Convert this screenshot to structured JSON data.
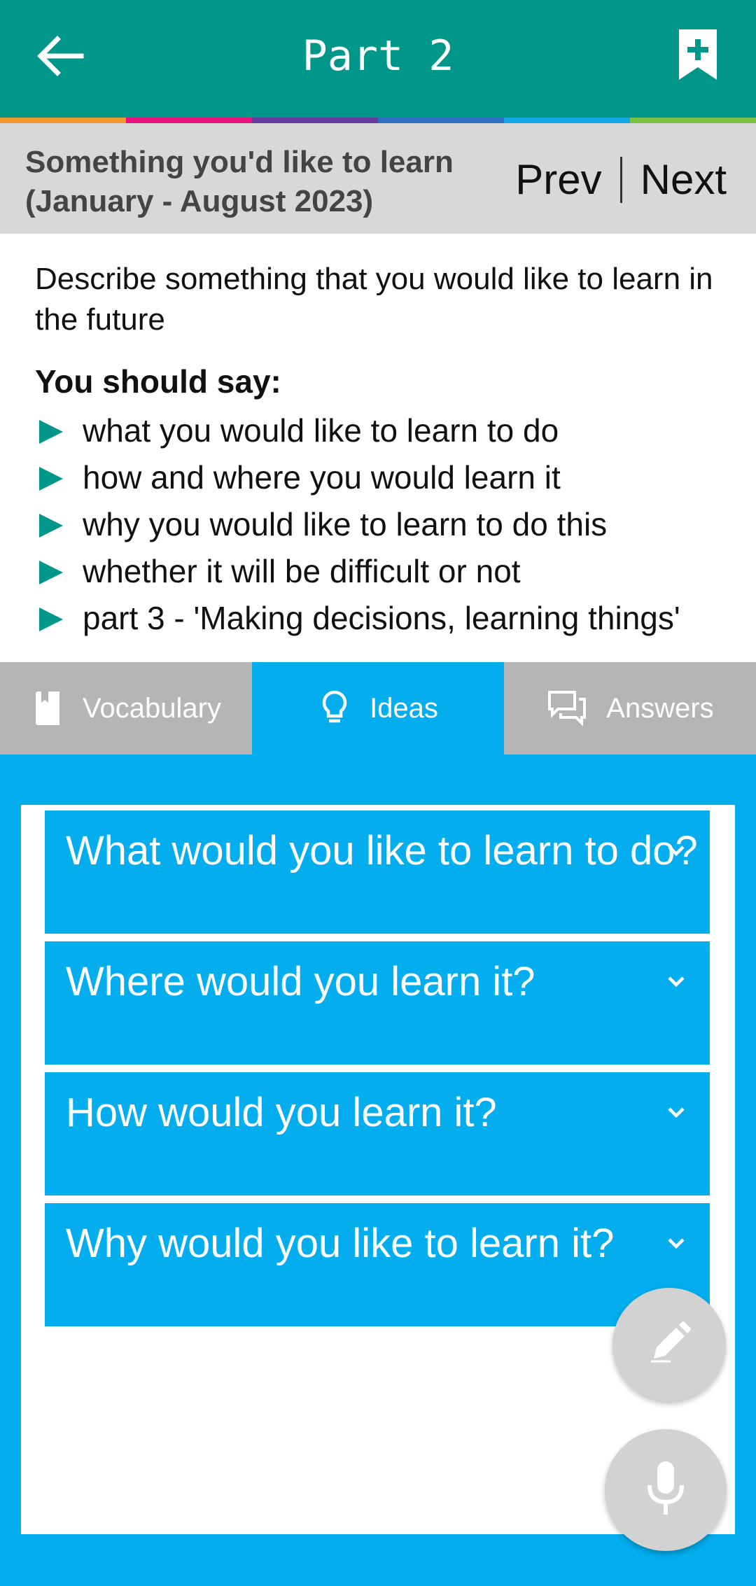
{
  "appbar": {
    "title": "Part 2",
    "back_icon": "arrow-left-icon",
    "bookmark_icon": "bookmark-add-icon"
  },
  "stripe_colors": [
    "#f19a2b",
    "#e9137d",
    "#6a3b9e",
    "#2e6fc0",
    "#12a9e6",
    "#7bc043"
  ],
  "topic": {
    "title_line1": "Something you'd like to learn",
    "title_line2": "(January - August 2023)",
    "prev_label": "Prev",
    "next_label": "Next"
  },
  "cue_card": {
    "prompt": "Describe something that you would like to learn in the future",
    "say_heading": "You should say:",
    "points": [
      "what you would like to learn to do",
      "how and where you would learn it",
      "why you would like to learn to do this",
      "whether it will be difficult or not",
      "part 3 - 'Making decisions, learning things'"
    ]
  },
  "tabs": [
    {
      "label": "Vocabulary",
      "icon": "book-icon",
      "active": false
    },
    {
      "label": "Ideas",
      "icon": "lightbulb-icon",
      "active": true
    },
    {
      "label": "Answers",
      "icon": "chat-bubbles-icon",
      "active": false
    }
  ],
  "ideas": [
    "What would you like to learn to do?",
    "Where would you learn it?",
    "How would you learn it?",
    "Why would you like to learn it?"
  ],
  "fabs": {
    "edit_icon": "pencil-icon",
    "mic_icon": "microphone-icon"
  },
  "colors": {
    "primary": "#00968a",
    "accent": "#03adee",
    "inactive_tab": "#b5b5b5"
  }
}
